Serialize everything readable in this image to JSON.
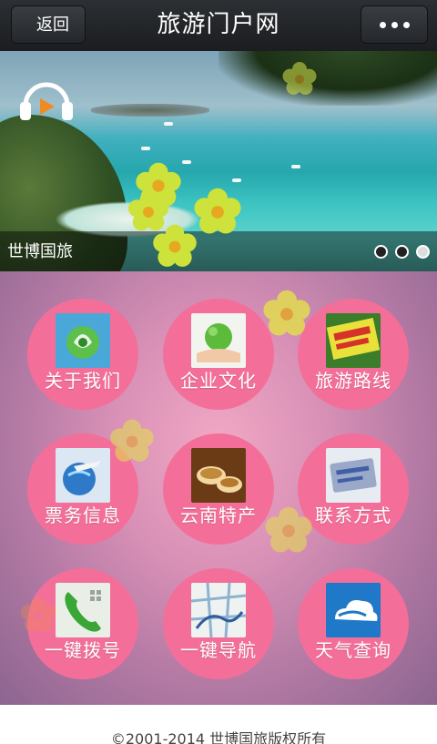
{
  "header": {
    "back_label": "返回",
    "title": "旅游门户网",
    "more_icon": "more-dots-icon"
  },
  "banner": {
    "caption": "世博国旅",
    "slide_count": 3,
    "active_slide": 3,
    "audio_icon": "headphones-play-icon"
  },
  "menu": {
    "items": [
      {
        "label": "关于我们",
        "icon": "about-logo-icon"
      },
      {
        "label": "企业文化",
        "icon": "hands-globe-icon"
      },
      {
        "label": "旅游路线",
        "icon": "travel-route-icon"
      },
      {
        "label": "票务信息",
        "icon": "airplane-globe-icon"
      },
      {
        "label": "云南特产",
        "icon": "tea-cups-icon"
      },
      {
        "label": "联系方式",
        "icon": "contact-card-icon"
      },
      {
        "label": "一键拨号",
        "icon": "phone-icon"
      },
      {
        "label": "一键导航",
        "icon": "map-icon"
      },
      {
        "label": "天气查询",
        "icon": "weather-icon"
      }
    ]
  },
  "footer": {
    "copyright": "©2001-2014 世博国旅版权所有"
  },
  "colors": {
    "header_bg": "#1b1d20",
    "tile_pink": "#f36f9a",
    "flower_yellow": "#d8e64a"
  }
}
